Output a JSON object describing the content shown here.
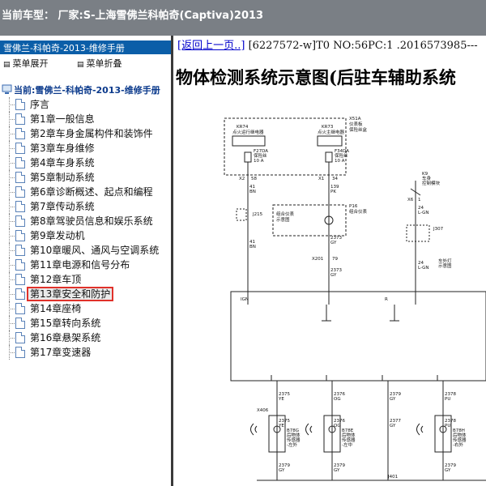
{
  "window": {
    "title": "当前车型： 厂家:S-上海雪佛兰科帕奇(Captiva)2013"
  },
  "sidebar": {
    "book_title": "雪佛兰-科帕奇-2013-维修手册",
    "expand_label": "菜单展开",
    "collapse_label": "菜单折叠",
    "current_label": "当前:雪佛兰-科帕奇-2013-维修手册",
    "items": [
      {
        "label": "序言"
      },
      {
        "label": "第1章一般信息"
      },
      {
        "label": "第2章车身金属构件和装饰件"
      },
      {
        "label": "第3章车身维修"
      },
      {
        "label": "第4章车身系统"
      },
      {
        "label": "第5章制动系统"
      },
      {
        "label": "第6章诊断概述、起点和编程"
      },
      {
        "label": "第7章传动系统"
      },
      {
        "label": "第8章驾驶员信息和娱乐系统"
      },
      {
        "label": "第9章发动机"
      },
      {
        "label": "第10章暖风、通风与空调系统"
      },
      {
        "label": "第11章电源和信号分布"
      },
      {
        "label": "第12章车顶"
      },
      {
        "label": "第13章安全和防护"
      },
      {
        "label": "第14章座椅"
      },
      {
        "label": "第15章转向系统"
      },
      {
        "label": "第16章悬架系统"
      },
      {
        "label": "第17章变速器"
      }
    ],
    "selected_index": 13
  },
  "content": {
    "back_link": "[返回上一页..]",
    "doc_info": "[6227572-w]T0 NO:56PC:1 .2016573985---",
    "title": "物体检测系统示意图(后驻车辅助系统"
  },
  "diagram": {
    "kr74_a": "KR74",
    "kr74_b": "点火运行继电器",
    "kr73_a": "KR73",
    "kr73_b": "点火主继电器",
    "x51a_a": "X51A",
    "x51a_b": "仪表板",
    "x51a_c": "保险丝盒",
    "f27da_a": "F27DA",
    "f27da_b": "保险丝",
    "f27da_c": "10 A",
    "f34da_a": "F34DA",
    "f34da_b": "保险丝",
    "f34da_c": "10 A",
    "pin_x2": "X2",
    "pin_58": "58",
    "pin_x1": "X1",
    "pin_34": "34",
    "w1_a": "41",
    "w1_b": "BN",
    "w2_a": "139",
    "w2_b": "PK",
    "j215": "J215",
    "p16_a": "P16",
    "p16_b": "组合仪表",
    "cluster_a": "组合仪表",
    "cluster_b": "示意图",
    "w3_a": "41",
    "w3_b": "BN",
    "w4_a": "2373",
    "w4_b": "GY",
    "x201": "X201",
    "pin_79": "79",
    "w5_a": "2373",
    "w5_b": "GY",
    "k9_a": "K9",
    "k9_b": "车身",
    "k9_c": "控制模块",
    "pin_x6": "X6",
    "pin_1": "1",
    "w6_a": "24",
    "w6_b": "L-GN",
    "j307": "J307",
    "lamp_a": "车外灯",
    "lamp_b": "示意图",
    "w7_a": "24",
    "w7_b": "L-GN",
    "ign": "IGN",
    "r": "R",
    "s1_a": "2375",
    "s1_b": "YE",
    "s2_a": "2376",
    "s2_b": "OG",
    "s3_a": "2379",
    "s3_b": "GY",
    "s4_a": "2378",
    "s4_b": "PU",
    "x406": "X406",
    "s5_a": "2375",
    "s5_b": "YE",
    "s6_a": "2376",
    "s6_b": "OG",
    "s7_a": "2377",
    "s7_b": "GY",
    "s8_a": "2378",
    "s8_b": "PU",
    "b78g_a": "B78G",
    "b78g_b": "后物体",
    "b78g_c": "传感器",
    "b78g_d": "-左外",
    "b78e_a": "B78E",
    "b78e_b": "后物体",
    "b78e_c": "传感器",
    "b78e_d": "-左中",
    "b78h_a": "B78H",
    "b78h_b": "后物体",
    "b78h_c": "传感器",
    "b78h_d": "-右外",
    "g1_a": "2379",
    "g1_b": "GY",
    "g2_a": "2379",
    "g2_b": "GY",
    "g3_a": "2379",
    "g3_b": "GY",
    "j401": "J401"
  }
}
